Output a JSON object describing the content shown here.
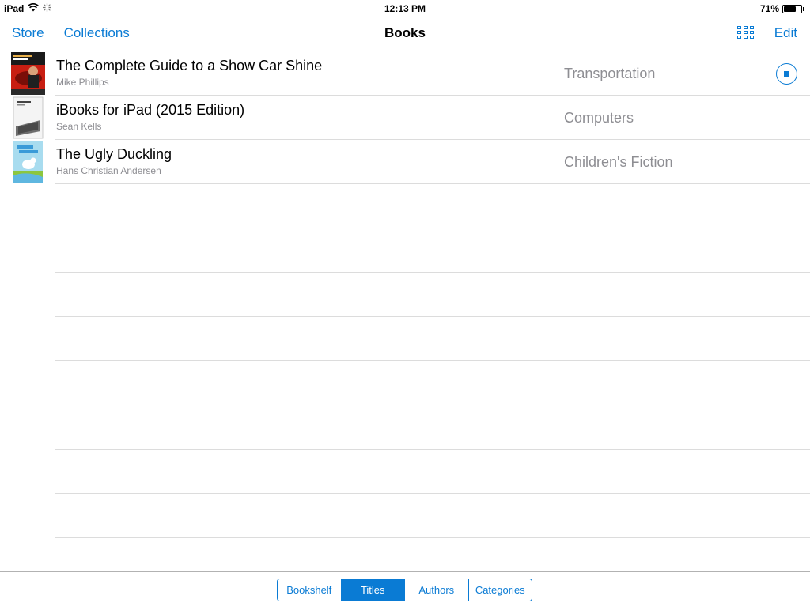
{
  "status_bar": {
    "device": "iPad",
    "time": "12:13 PM",
    "battery": "71%",
    "battery_level": 0.71
  },
  "nav": {
    "store": "Store",
    "collections": "Collections",
    "title": "Books",
    "edit": "Edit",
    "grid_icon": "grid-view-icon"
  },
  "books": [
    {
      "title": "The Complete Guide to a Show Car Shine",
      "author": "Mike Phillips",
      "category": "Transportation",
      "downloading": true
    },
    {
      "title": "iBooks for iPad (2015 Edition)",
      "author": "Sean Kells",
      "category": "Computers"
    },
    {
      "title": "The Ugly Duckling",
      "author": "Hans Christian Andersen",
      "category": "Children's Fiction"
    }
  ],
  "tabs": {
    "items": [
      "Bookshelf",
      "Titles",
      "Authors",
      "Categories"
    ],
    "selected": "Titles"
  },
  "colors": {
    "accent": "#0a7bd4",
    "secondary_text": "#8e8e93",
    "separator": "#dcdcdc"
  }
}
